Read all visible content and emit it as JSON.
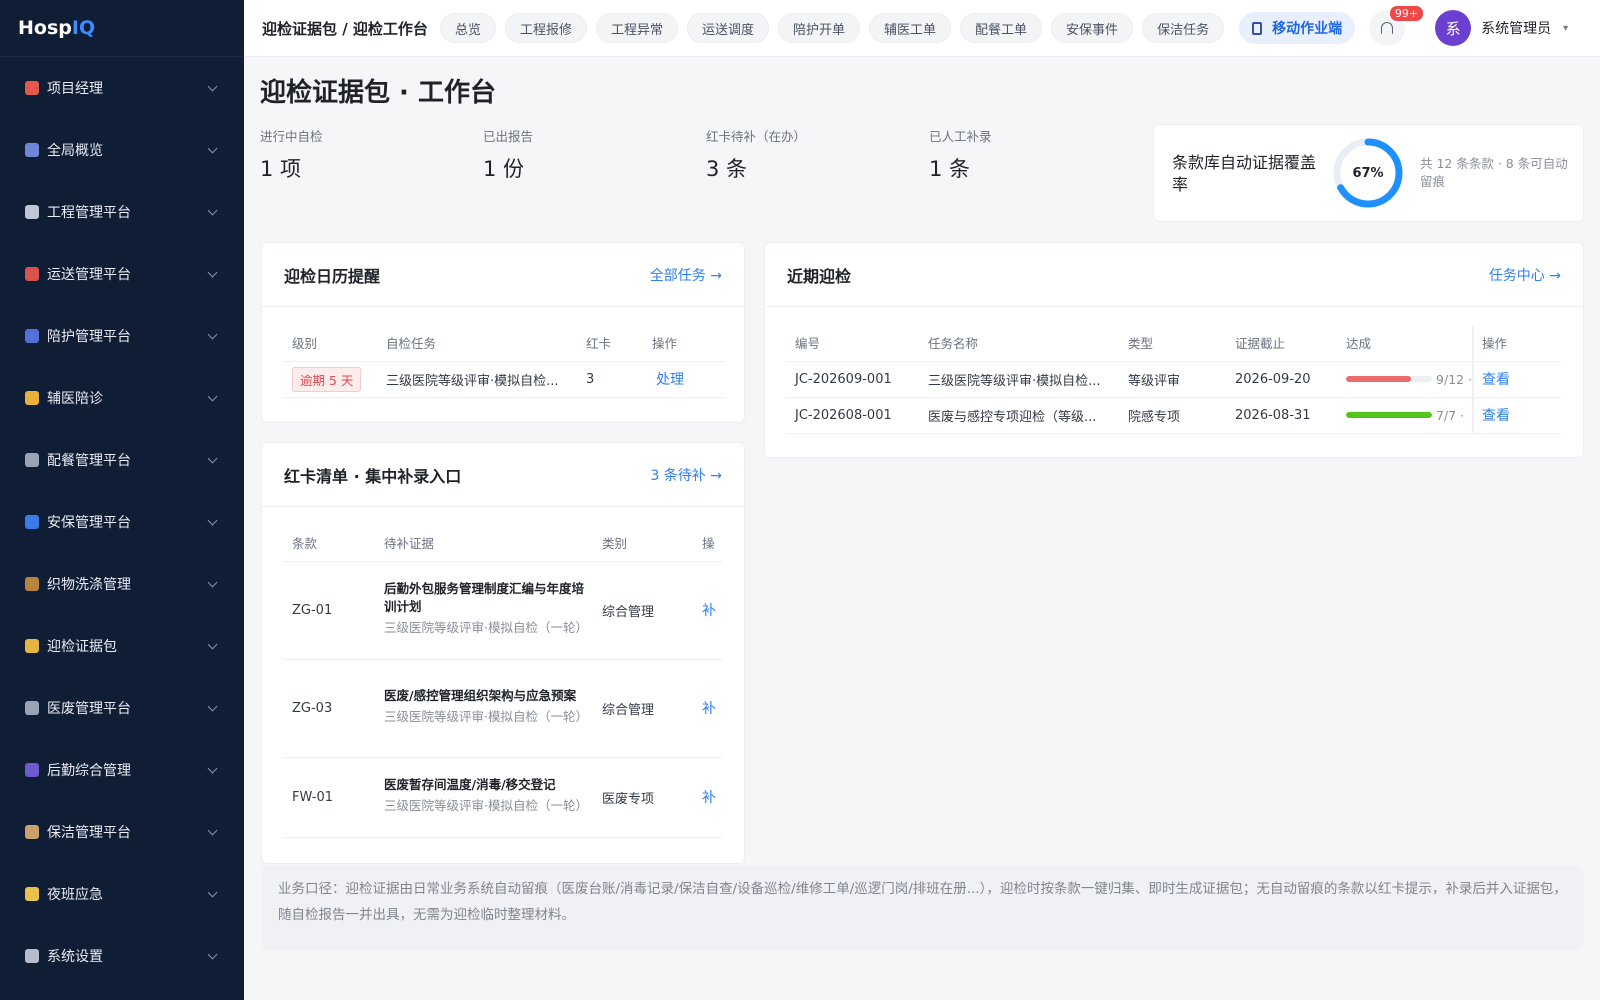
{
  "app": {
    "logo_main": "Hosp",
    "logo_accent": "IQ"
  },
  "sidebar": {
    "items": [
      {
        "label": "项目经理",
        "icon": "target-icon",
        "color": "#e4574b"
      },
      {
        "label": "全局概览",
        "icon": "chart-icon",
        "color": "#6f86d6"
      },
      {
        "label": "工程管理平台",
        "icon": "tools-icon",
        "color": "#c0c6d4"
      },
      {
        "label": "运送管理平台",
        "icon": "ambulance-icon",
        "color": "#d8534f"
      },
      {
        "label": "陪护管理平台",
        "icon": "bed-icon",
        "color": "#5470d6"
      },
      {
        "label": "辅医陪诊",
        "icon": "heart-icon",
        "color": "#e8b23a"
      },
      {
        "label": "配餐管理平台",
        "icon": "food-icon",
        "color": "#9aa3b5"
      },
      {
        "label": "安保管理平台",
        "icon": "shield-icon",
        "color": "#3b7be8"
      },
      {
        "label": "织物洗涤管理",
        "icon": "basket-icon",
        "color": "#b8843d"
      },
      {
        "label": "迎检证据包",
        "icon": "folder-icon",
        "color": "#e5b442"
      },
      {
        "label": "医废管理平台",
        "icon": "trash-icon",
        "color": "#9aa3b5"
      },
      {
        "label": "后勤综合管理",
        "icon": "team-icon",
        "color": "#6a5acd"
      },
      {
        "label": "保洁管理平台",
        "icon": "broom-icon",
        "color": "#c9a06a"
      },
      {
        "label": "夜班应急",
        "icon": "moon-icon",
        "color": "#e8c24a"
      },
      {
        "label": "系统设置",
        "icon": "gear-icon",
        "color": "#b6bcc9"
      }
    ]
  },
  "topbar": {
    "breadcrumb": "迎检证据包 / 迎检工作台",
    "chips": [
      "总览",
      "工程报修",
      "工程异常",
      "运送调度",
      "陪护开单",
      "辅医工单",
      "配餐工单",
      "安保事件",
      "保洁任务"
    ],
    "mobile_label": "移动作业端",
    "badge": "99+",
    "avatar_char": "系",
    "username": "系统管理员",
    "caret": "▾"
  },
  "page": {
    "title": "迎检证据包 · 工作台"
  },
  "stats": [
    {
      "label": "进行中自检",
      "value": "1 项"
    },
    {
      "label": "已出报告",
      "value": "1 份"
    },
    {
      "label": "红卡待补（在办）",
      "value": "3 条"
    },
    {
      "label": "已人工补录",
      "value": "1 条"
    }
  ],
  "coverage": {
    "title": "条款库自动证据覆盖率",
    "percent_label": "67%",
    "percent": 67,
    "note": "共 12 条条款 · 8 条可自动留痕",
    "color": "#1e90ff"
  },
  "calendar": {
    "title": "迎检日历提醒",
    "link": "全部任务 →",
    "columns": [
      "级别",
      "自检任务",
      "红卡",
      "操作"
    ],
    "rows": [
      {
        "level": "逾期 5 天",
        "task": "三级医院等级评审·模拟自检...",
        "red": "3",
        "action": "处理"
      }
    ]
  },
  "recent": {
    "title": "近期迎检",
    "link": "任务中心 →",
    "columns": [
      "编号",
      "任务名称",
      "类型",
      "证据截止",
      "达成",
      "操作"
    ],
    "rows": [
      {
        "id": "JC-202609-001",
        "name": "三级医院等级评审·模拟自检...",
        "type": "等级评审",
        "deadline": "2026-09-20",
        "progress": 0.75,
        "progress_label": "9/12 ·",
        "bar_color": "#ec6a6a",
        "action": "查看"
      },
      {
        "id": "JC-202608-001",
        "name": "医废与感控专项迎检（等级...",
        "type": "院感专项",
        "deadline": "2026-08-31",
        "progress": 1.0,
        "progress_label": "7/7 ·",
        "bar_color": "#52c41a",
        "action": "查看"
      }
    ]
  },
  "redcards": {
    "title": "红卡清单 · 集中补录入口",
    "link": "3 条待补 →",
    "columns": [
      "条款",
      "待补证据",
      "类别",
      "操"
    ],
    "rows": [
      {
        "code": "ZG-01",
        "title": "后勤外包服务管理制度汇编与年度培训计划",
        "sub": "三级医院等级评审·模拟自检（一轮）",
        "category": "综合管理",
        "action": "补"
      },
      {
        "code": "ZG-03",
        "title": "医废/感控管理组织架构与应急预案",
        "sub": "三级医院等级评审·模拟自检（一轮）",
        "category": "综合管理",
        "action": "补"
      },
      {
        "code": "FW-01",
        "title": "医废暂存间温度/消毒/移交登记",
        "sub": "三级医院等级评审·模拟自检（一轮）",
        "category": "医废专项",
        "action": "补"
      }
    ]
  },
  "footer": {
    "note": "业务口径：迎检证据由日常业务系统自动留痕（医废台账/消毒记录/保洁自查/设备巡检/维修工单/巡逻门岗/排班在册...），迎检时按条款一键归集、即时生成证据包；无自动留痕的条款以红卡提示，补录后并入证据包，随自检报告一并出具，无需为迎检临时整理材料。"
  }
}
